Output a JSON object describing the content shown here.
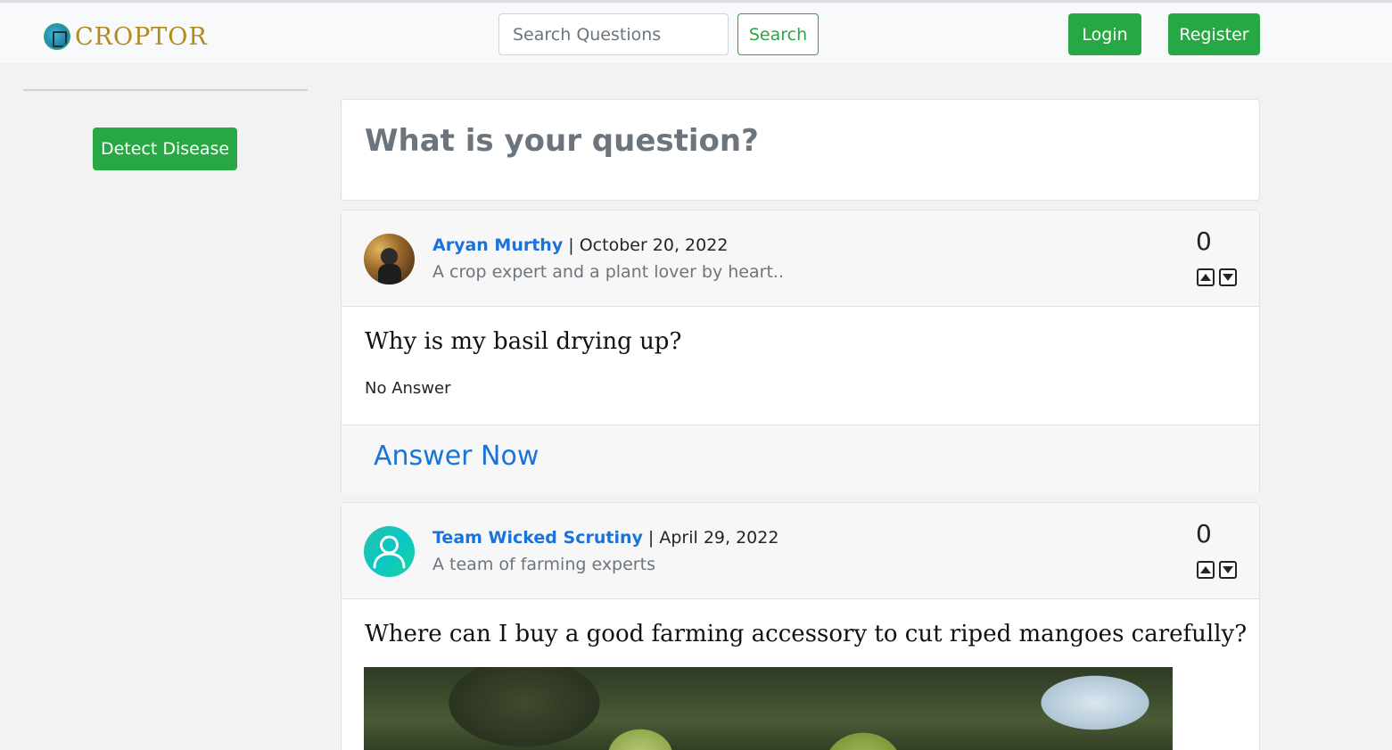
{
  "navbar": {
    "brand": "CROPTOR",
    "search_placeholder": "Search Questions",
    "search_label": "Search",
    "login_label": "Login",
    "register_label": "Register"
  },
  "sidebar": {
    "detect_label": "Detect Disease"
  },
  "ask": {
    "prompt": "What is your question?"
  },
  "questions": [
    {
      "author": "Aryan Murthy",
      "date": "| October 20, 2022",
      "bio": "A crop expert and a plant lover by heart..",
      "votes": "0",
      "title": "Why is my basil drying up?",
      "answer": "No Answer",
      "answer_now": "Answer Now"
    },
    {
      "author": "Team Wicked Scrutiny",
      "date": "| April 29, 2022",
      "bio": "A team of farming experts",
      "votes": "0",
      "title": "Where can I buy a good farming accessory to cut riped mangoes carefully?"
    }
  ],
  "colors": {
    "primary_green": "#28a745",
    "link_blue": "#1a73d9",
    "brand_gold": "#b08a1c"
  }
}
